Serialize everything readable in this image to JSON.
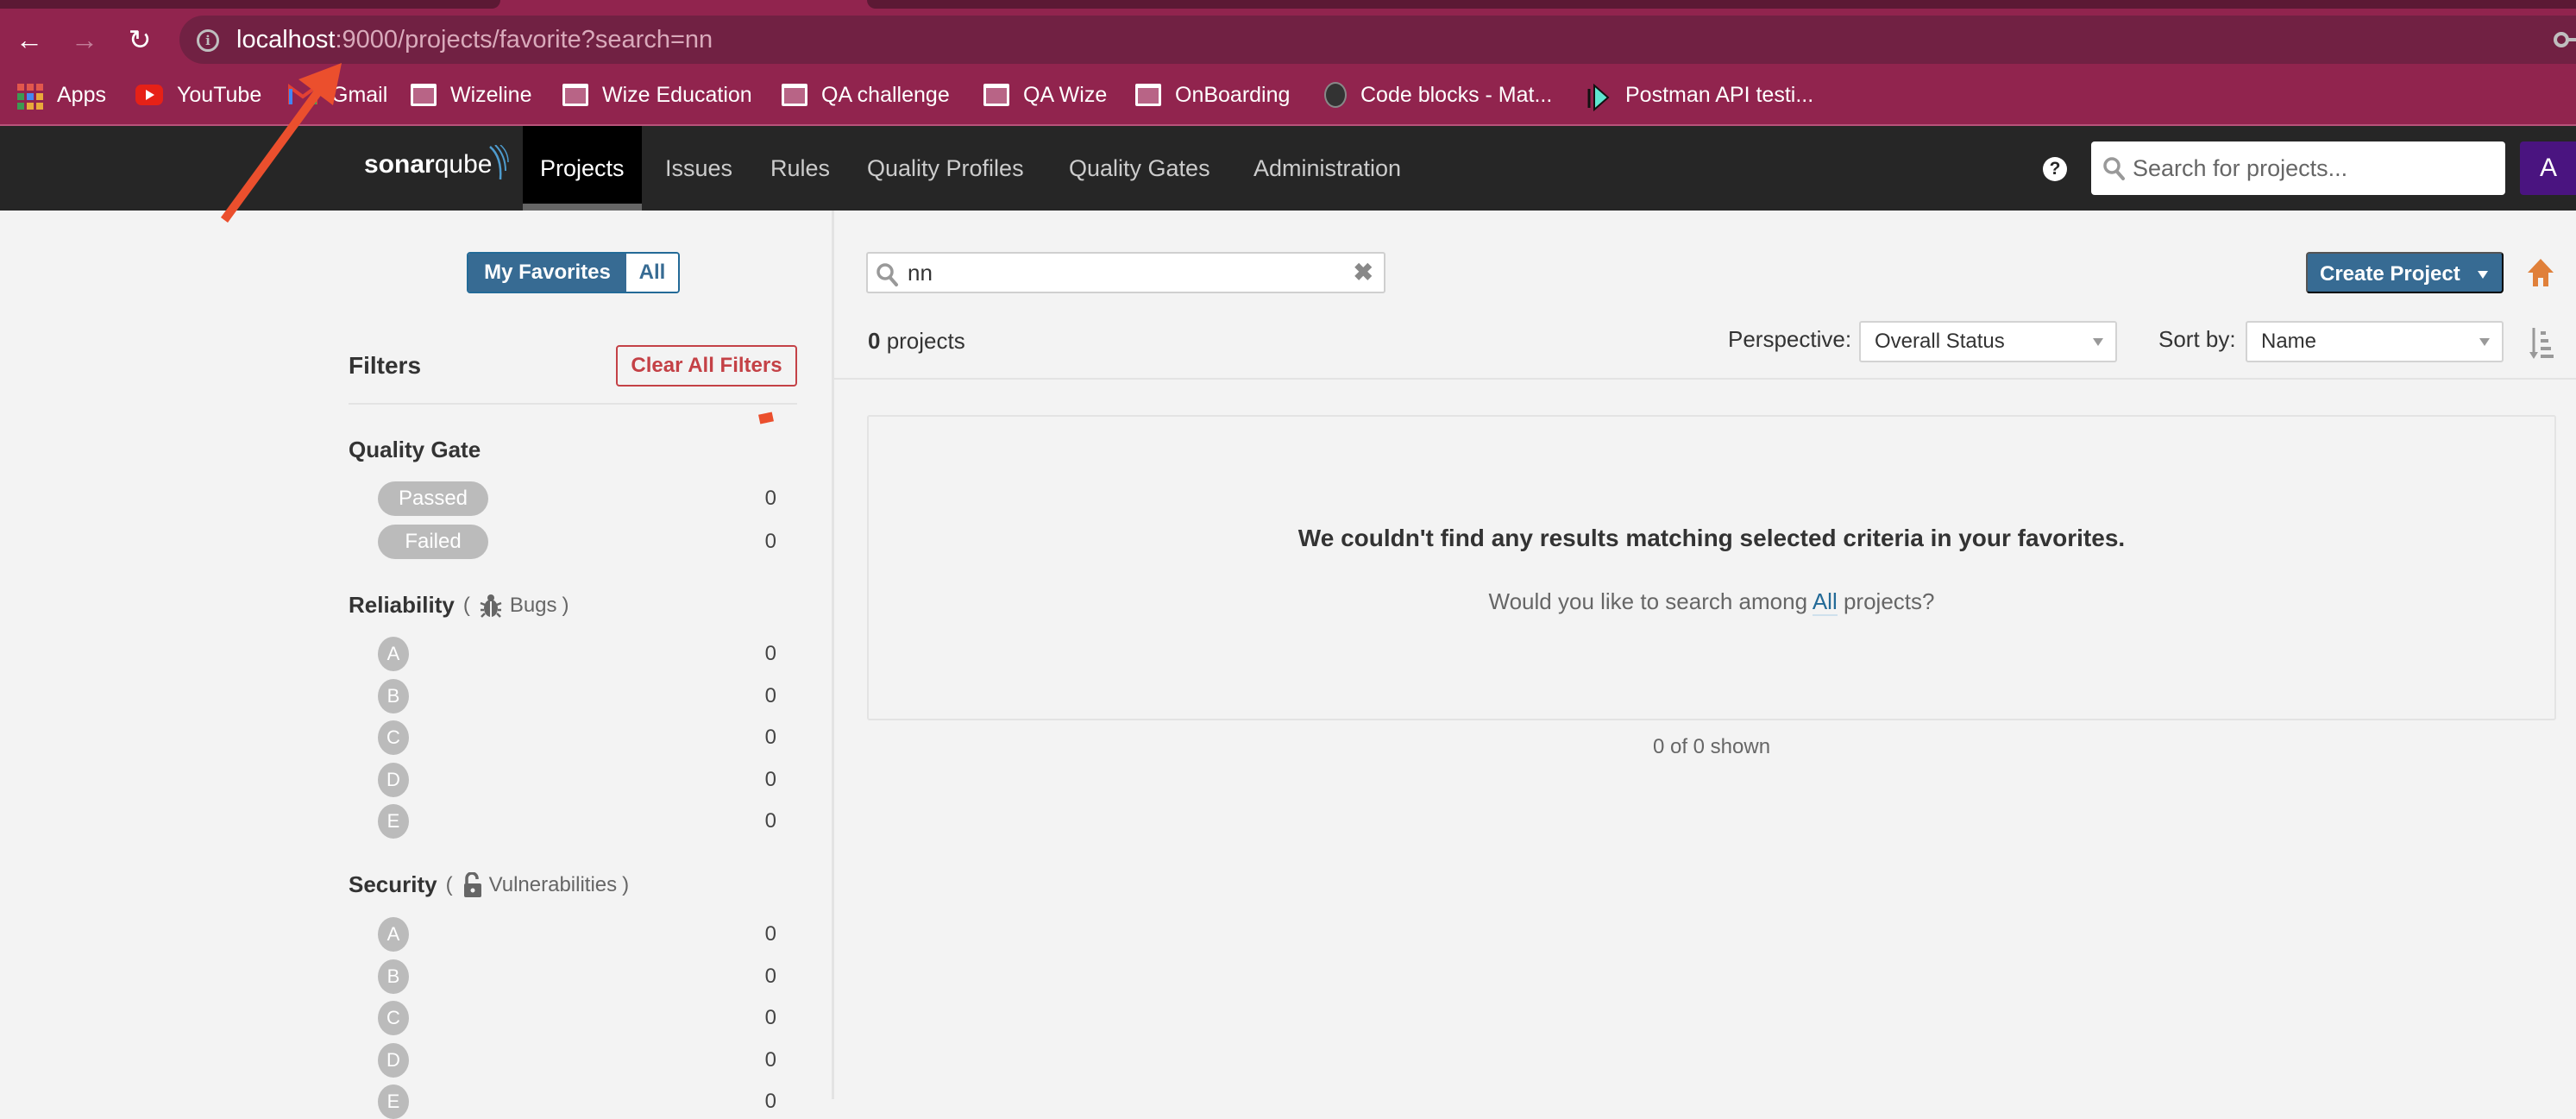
{
  "browser": {
    "url_host": "localhost",
    "url_rest": ":9000/projects/favorite?search=nn",
    "bookmarks": [
      {
        "label": "Apps",
        "icon": "apps-grid-icon"
      },
      {
        "label": "YouTube",
        "icon": "youtube-icon"
      },
      {
        "label": "Gmail",
        "icon": "gmail-icon"
      },
      {
        "label": "Wizeline",
        "icon": "folder-icon"
      },
      {
        "label": "Wize Education",
        "icon": "folder-icon"
      },
      {
        "label": "QA challenge",
        "icon": "folder-icon"
      },
      {
        "label": "QA Wize",
        "icon": "folder-icon"
      },
      {
        "label": "OnBoarding",
        "icon": "folder-icon"
      },
      {
        "label": "Code blocks - Mat...",
        "icon": "code-blocks-icon"
      },
      {
        "label": "Postman API testi...",
        "icon": "postman-icon"
      }
    ]
  },
  "nav": {
    "logo_bold": "sonar",
    "logo_light": "qube",
    "tabs": [
      {
        "label": "Projects",
        "active": true
      },
      {
        "label": "Issues"
      },
      {
        "label": "Rules"
      },
      {
        "label": "Quality Profiles"
      },
      {
        "label": "Quality Gates"
      },
      {
        "label": "Administration"
      }
    ],
    "help_glyph": "?",
    "search_placeholder": "Search for projects...",
    "avatar_letter": "A",
    "colors": {
      "bar": "#262626",
      "avatar": "#4a1480"
    }
  },
  "sidebar": {
    "toggle": {
      "favorites": "My Favorites",
      "all": "All",
      "selected": "My Favorites"
    },
    "filters_title": "Filters",
    "clear_filters": "Clear All Filters",
    "quality_gate": {
      "title": "Quality Gate",
      "options": [
        {
          "label": "Passed",
          "count": "0"
        },
        {
          "label": "Failed",
          "count": "0"
        }
      ]
    },
    "reliability": {
      "title": "Reliability",
      "open_paren": "(",
      "metric": "Bugs",
      "close_paren": ")",
      "grades": [
        {
          "label": "A",
          "count": "0"
        },
        {
          "label": "B",
          "count": "0"
        },
        {
          "label": "C",
          "count": "0"
        },
        {
          "label": "D",
          "count": "0"
        },
        {
          "label": "E",
          "count": "0"
        }
      ]
    },
    "security": {
      "title": "Security",
      "open_paren": "(",
      "metric": "Vulnerabilities",
      "close_paren": ")",
      "grades": [
        {
          "label": "A",
          "count": "0"
        },
        {
          "label": "B",
          "count": "0"
        },
        {
          "label": "C",
          "count": "0"
        },
        {
          "label": "D",
          "count": "0"
        },
        {
          "label": "E",
          "count": "0"
        }
      ]
    }
  },
  "main": {
    "search_value": "nn",
    "clear_glyph": "✖",
    "count_number": "0",
    "count_label": " projects",
    "create_project": "Create Project",
    "perspective_label": "Perspective:",
    "perspective_value": "Overall Status",
    "sort_label": "Sort by:",
    "sort_value": "Name",
    "empty_title": "We couldn't find any results matching selected criteria in your favorites.",
    "empty_sub_before": "Would you like to search among ",
    "empty_sub_link": "All",
    "empty_sub_after": " projects?",
    "shown": "0 of 0 shown",
    "colors": {
      "primary": "#376b93",
      "danger": "#c44146",
      "home": "#e0803a"
    }
  }
}
